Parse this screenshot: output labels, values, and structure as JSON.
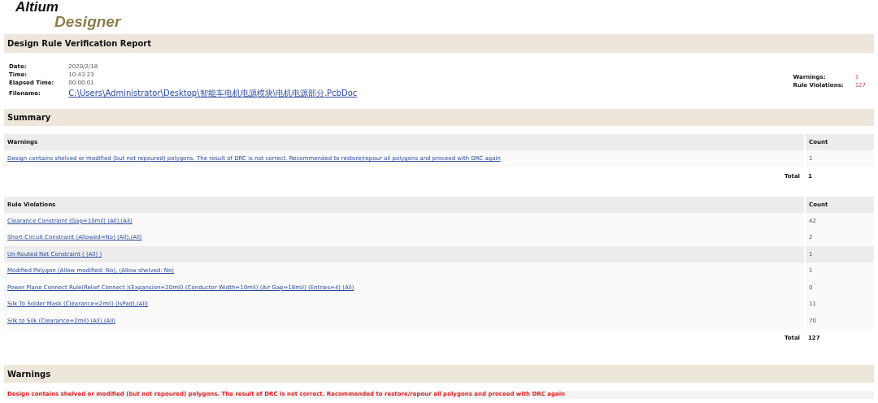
{
  "logo": {
    "line_1": "Altium",
    "line_2": "Designer"
  },
  "title": "Design Rule Verification Report",
  "info": [
    {
      "label": "Date:",
      "value": "2020/2/18",
      "kind": "text"
    },
    {
      "label": "Time:",
      "value": "10:43:23",
      "kind": "text"
    },
    {
      "label": "Elapsed Time:",
      "value": "00:00:01",
      "kind": "text"
    },
    {
      "label": "Filename:",
      "value": "C:\\Users\\Administrator\\Desktop\\智能车电机电源模块\\电机电源部分.PcbDoc",
      "kind": "link"
    }
  ],
  "totals": [
    {
      "label": "Warnings:",
      "value": "1"
    },
    {
      "label": "Rule Violations:",
      "value": "127"
    }
  ],
  "summary_heading": "Summary",
  "tables": [
    {
      "heading": "Warnings",
      "count_heading": "Count",
      "total_label": "Total",
      "total": "1",
      "rows": [
        {
          "name": "Design contains shelved or modified (but not repoured) polygons. The result of DRC is not correct. Recommended to restore/repour all polygons and proceed with DRC again",
          "count": "1",
          "highlighted": false
        }
      ]
    },
    {
      "heading": "Rule Violations",
      "count_heading": "Count",
      "total_label": "Total",
      "total": "127",
      "rows": [
        {
          "name": "Clearance Constraint (Gap=10mil) (All),(All)",
          "count": "42",
          "highlighted": false
        },
        {
          "name": "Short-Circuit Constraint (Allowed=No) (All),(All)",
          "count": "2",
          "highlighted": false
        },
        {
          "name": "Un-Routed Net Constraint ( (All) )",
          "count": "1",
          "highlighted": true
        },
        {
          "name": "Modified Polygon (Allow modified: No), (Allow shelved: No)",
          "count": "1",
          "highlighted": false
        },
        {
          "name": "Power Plane Connect Rule(Relief Connect )(Expansion=20mil) (Conductor Width=10mil) (Air Gap=18mil) (Entries=4) (All)",
          "count": "0",
          "highlighted": false
        },
        {
          "name": "Silk To Solder Mask (Clearance=2mil) (IsPad),(All)",
          "count": "11",
          "highlighted": false
        },
        {
          "name": "Silk to Silk (Clearance=2mil) (All),(All)",
          "count": "70",
          "highlighted": false
        }
      ]
    }
  ],
  "detail_heading": "Warnings",
  "detail_message": "Design contains shelved or modified (but not repoured) polygons. The result of DRC is not correct. Recommended to restore/repour all polygons and proceed with DRC again"
}
